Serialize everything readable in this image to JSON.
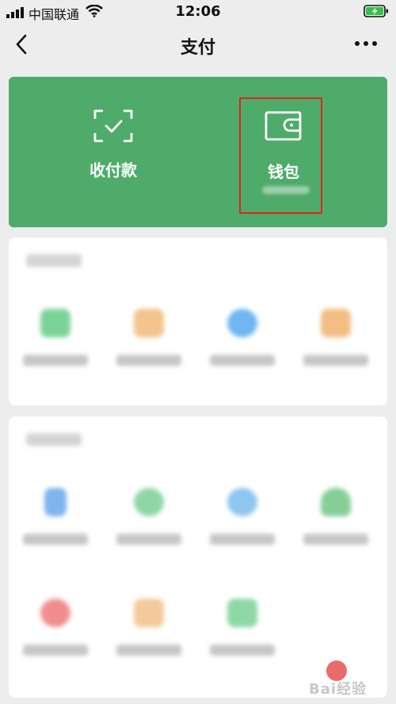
{
  "status_bar": {
    "carrier": "中国联通",
    "time": "12:06"
  },
  "nav": {
    "title": "支付",
    "back_icon": "chevron-left-icon",
    "more_icon": "more-dots-icon"
  },
  "pay_card": {
    "background": "#4eab6a",
    "receive_label": "收付款",
    "receive_icon": "scan-check-icon",
    "wallet_label": "钱包",
    "wallet_icon": "wallet-icon",
    "highlight_color": "#e2231a"
  },
  "finance_section": {
    "items": [
      {
        "icon": "card-repayment-icon",
        "color": "#7cd39a"
      },
      {
        "icon": "micro-loan-icon",
        "color": "#f3c48d"
      },
      {
        "icon": "wealth-icon",
        "color": "#6fb6f2"
      },
      {
        "icon": "insurance-icon",
        "color": "#f4bd84"
      }
    ]
  },
  "life_section": {
    "items": [
      {
        "icon": "phone-topup-icon",
        "color": "#7fb4ee"
      },
      {
        "icon": "utilities-icon",
        "color": "#8fd6a5"
      },
      {
        "icon": "bus-card-icon",
        "color": "#8fc6f0"
      },
      {
        "icon": "city-services-icon",
        "color": "#86cf99"
      },
      {
        "icon": "charity-icon",
        "color": "#f08e8e"
      },
      {
        "icon": "medical-icon",
        "color": "#f4c99b"
      },
      {
        "icon": "health-code-icon",
        "color": "#8ed8a6"
      }
    ]
  },
  "watermark": {
    "text": "Bai经验"
  }
}
